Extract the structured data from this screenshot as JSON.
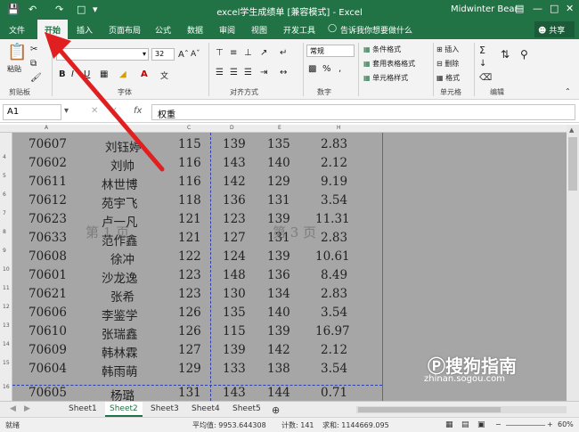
{
  "title": "excel学生成绩单 [兼容模式] - Excel",
  "user": "Midwinter Bear",
  "share_label": "共享",
  "tabs": [
    "文件",
    "开始",
    "插入",
    "页面布局",
    "公式",
    "数据",
    "审阅",
    "视图",
    "开发工具"
  ],
  "active_tab": "开始",
  "tell_me": "告诉我你想要做什么",
  "ribbon": {
    "paste": "粘贴",
    "clipboard": "剪贴板",
    "font_group": "字体",
    "font_size": "32",
    "align_group": "对齐方式",
    "number_group": "数字",
    "number_format": "常规",
    "styles": [
      "条件格式",
      "套用表格格式",
      "单元格样式"
    ],
    "cells": [
      "插入",
      "删除",
      "格式"
    ],
    "cells_group": "单元格",
    "edit_group": "编辑"
  },
  "formula_bar": {
    "name_box": "A1",
    "fx": "fx",
    "content": "权重"
  },
  "columns": [
    "A",
    "B",
    "C",
    "D",
    "E",
    "H"
  ],
  "row_numbers": [
    "4",
    "5",
    "6",
    "7",
    "8",
    "9",
    "10",
    "11",
    "12",
    "13",
    "14",
    "15",
    "16"
  ],
  "rows": [
    {
      "id": "70607",
      "name": "刘钰婷",
      "c": "115",
      "d": "139",
      "e": "135",
      "h": "2.83"
    },
    {
      "id": "70602",
      "name": "刘帅",
      "c": "116",
      "d": "143",
      "e": "140",
      "h": "2.12"
    },
    {
      "id": "70611",
      "name": "林世博",
      "c": "116",
      "d": "142",
      "e": "129",
      "h": "9.19"
    },
    {
      "id": "70612",
      "name": "苑宇飞",
      "c": "118",
      "d": "136",
      "e": "131",
      "h": "3.54"
    },
    {
      "id": "70623",
      "name": "卢一凡",
      "c": "121",
      "d": "123",
      "e": "139",
      "h": "11.31"
    },
    {
      "id": "70633",
      "name": "范作鑫",
      "c": "121",
      "d": "127",
      "e": "131",
      "h": "2.83"
    },
    {
      "id": "70608",
      "name": "徐冲",
      "c": "122",
      "d": "124",
      "e": "139",
      "h": "10.61"
    },
    {
      "id": "70601",
      "name": "沙龙逸",
      "c": "123",
      "d": "148",
      "e": "136",
      "h": "8.49"
    },
    {
      "id": "70621",
      "name": "张希",
      "c": "123",
      "d": "130",
      "e": "134",
      "h": "2.83"
    },
    {
      "id": "70606",
      "name": "李鉴学",
      "c": "126",
      "d": "135",
      "e": "140",
      "h": "3.54"
    },
    {
      "id": "70610",
      "name": "张瑞鑫",
      "c": "126",
      "d": "115",
      "e": "139",
      "h": "16.97"
    },
    {
      "id": "70609",
      "name": "韩林霖",
      "c": "127",
      "d": "139",
      "e": "142",
      "h": "2.12"
    },
    {
      "id": "70604",
      "name": "韩雨萌",
      "c": "129",
      "d": "133",
      "e": "138",
      "h": "3.54"
    },
    {
      "id": "70605",
      "name": "杨璐",
      "c": "131",
      "d": "143",
      "e": "144",
      "h": "0.71"
    }
  ],
  "watermarks": [
    "第 1 页",
    "第 3 页"
  ],
  "sheet_tabs": [
    "Sheet1",
    "Sheet2",
    "Sheet3",
    "Sheet4",
    "Sheet5"
  ],
  "active_sheet": "Sheet2",
  "status": {
    "ready": "就绪",
    "average": "平均值: 9953.644308",
    "count": "计数: 141",
    "sum": "求和: 1144669.095",
    "zoom": "60%"
  },
  "logo": "搜狗指南",
  "logo_sub": "zhinan.sogou.com",
  "colors": {
    "excel_green": "#217346",
    "page_break": "#2b3fb0",
    "arrow": "#e02020"
  }
}
